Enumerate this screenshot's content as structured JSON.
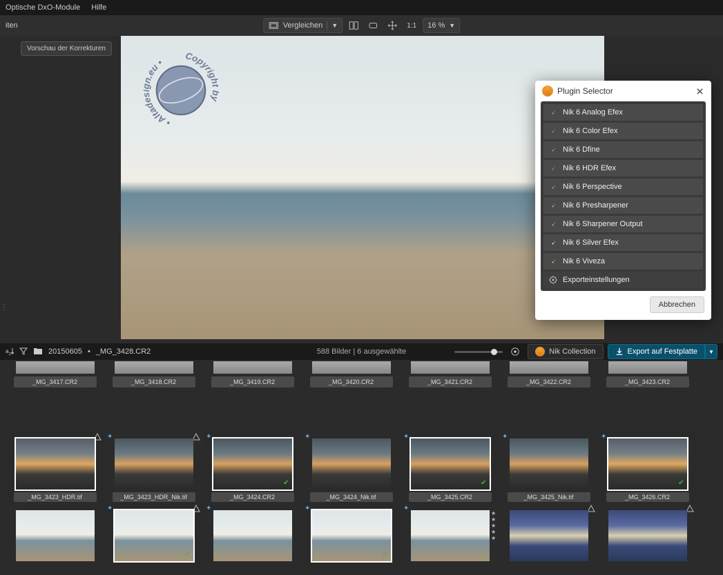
{
  "menu": {
    "modules": "Optische DxO-Module",
    "help": "Hilfe"
  },
  "subbar": {
    "left": "iten",
    "compare": "Vergleichen",
    "oneone": "1:1",
    "zoom": "16 %"
  },
  "preview": {
    "badge": "Vorschau der Korrekturen"
  },
  "pathbar": {
    "folder": "20150605",
    "file": "_MG_3428.CR2",
    "sep": "•",
    "count": "588 Bilder | 6 ausgewählte",
    "nik": "Nik Collection",
    "export": "Export auf Festplatte"
  },
  "dlg": {
    "title": "Plugin Selector",
    "items": [
      {
        "label": "Nik 6 Analog Efex",
        "color": "#f08030"
      },
      {
        "label": "Nik 6 Color Efex",
        "color": "#6a8ad0"
      },
      {
        "label": "Nik 6 Dfine",
        "color": "#8aa0e0"
      },
      {
        "label": "Nik 6 HDR Efex",
        "color": "#5090e0"
      },
      {
        "label": "Nik 6 Perspective",
        "color": "#60c888"
      },
      {
        "label": "Nik 6 Presharpener",
        "color": "#70d070"
      },
      {
        "label": "Nik 6 Sharpener Output",
        "color": "#70d070"
      },
      {
        "label": "Nik 6 Silver Efex",
        "color": "#ddd"
      },
      {
        "label": "Nik 6 Viveza",
        "color": "#f0b030"
      }
    ],
    "settings": "Exporteinstellungen",
    "cancel": "Abbrechen"
  },
  "row1": [
    {
      "label": "_MG_3417.CR2"
    },
    {
      "label": "_MG_3418.CR2"
    },
    {
      "label": "_MG_3419.CR2"
    },
    {
      "label": "_MG_3420.CR2"
    },
    {
      "label": "_MG_3421.CR2"
    },
    {
      "label": "_MG_3422.CR2"
    },
    {
      "label": "_MG_3423.CR2"
    }
  ],
  "row2": [
    {
      "label": "_MG_3423_HDR.tif",
      "sel": true,
      "cls": "sky2",
      "corner": true
    },
    {
      "label": "_MG_3423_HDR_Nik.tif",
      "sel": false,
      "cls": "sky1",
      "corner": true,
      "star": "+"
    },
    {
      "label": "_MG_3424.CR2",
      "sel": true,
      "cls": "sky1",
      "star": "+",
      "chk": true
    },
    {
      "label": "_MG_3424_Nik.tif",
      "sel": false,
      "cls": "sky1",
      "star": "+"
    },
    {
      "label": "_MG_3425.CR2",
      "sel": true,
      "cls": "sky1",
      "star": "+",
      "chk": true
    },
    {
      "label": "_MG_3425_Nik.tif",
      "sel": false,
      "cls": "sky1",
      "star": "+"
    },
    {
      "label": "_MG_3426.CR2",
      "sel": true,
      "cls": "sky2",
      "star": "+",
      "chk": true
    }
  ],
  "row3": [
    {
      "cls": "sky3",
      "sel": false
    },
    {
      "cls": "sky3",
      "sel": true,
      "star": "+",
      "chk": true,
      "corner": true
    },
    {
      "cls": "sky3",
      "sel": false,
      "star": "+"
    },
    {
      "cls": "sky3",
      "sel": true,
      "star": "+",
      "chk": true
    },
    {
      "cls": "sky3",
      "sel": false,
      "star": "+"
    },
    {
      "cls": "sky4",
      "sel": false,
      "star5": true,
      "corner": true
    },
    {
      "cls": "sky4",
      "sel": false,
      "corner": true
    }
  ]
}
